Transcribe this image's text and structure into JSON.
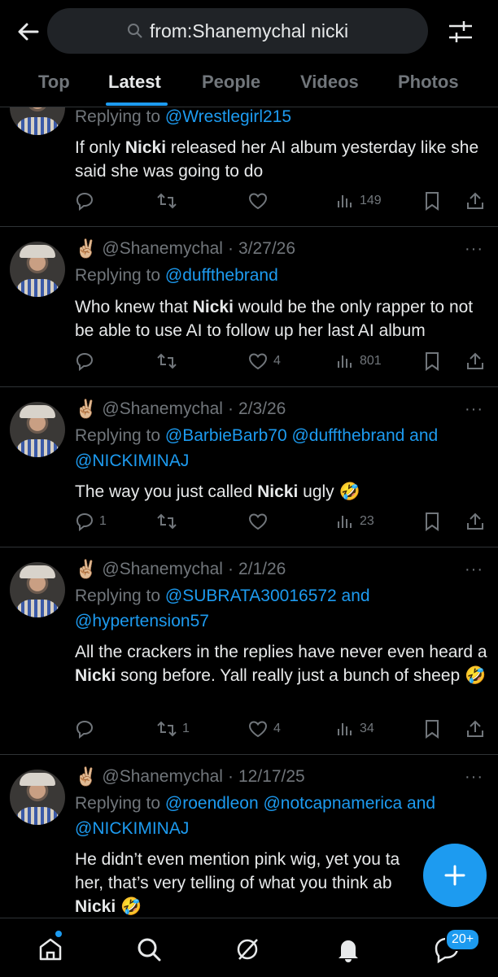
{
  "search": {
    "query": "from:Shanemychal nicki"
  },
  "tabs": [
    "Top",
    "Latest",
    "People",
    "Videos",
    "Photos"
  ],
  "tweets": [
    {
      "reply_prefix": "Replying to",
      "mentions": "@Wrestlegirl215",
      "text_a": "If only ",
      "text_b": "Nicki",
      "text_c": " released her AI album yesterday like she said she was going to do",
      "replies": "",
      "retweets": "",
      "likes": "",
      "views": "149"
    },
    {
      "emoji": "✌🏼",
      "handle": "@Shanemychal",
      "date": "3/27/26",
      "reply_prefix": "Replying to",
      "mentions": "@duffthebrand",
      "text_a": "Who knew that ",
      "text_b": "Nicki",
      "text_c": " would be the only rapper to not be able to use AI to follow up her last AI album",
      "replies": "",
      "retweets": "",
      "likes": "4",
      "views": "801"
    },
    {
      "emoji": "✌🏼",
      "handle": "@Shanemychal",
      "date": "2/3/26",
      "reply_prefix": "Replying to",
      "mentions": "@BarbieBarb70 @duffthebrand and @NICKIMINAJ",
      "text_a": "The way you just called ",
      "text_b": "Nicki",
      "text_c": " ugly 🤣",
      "replies": "1",
      "retweets": "",
      "likes": "",
      "views": "23"
    },
    {
      "emoji": "✌🏼",
      "handle": "@Shanemychal",
      "date": "2/1/26",
      "reply_prefix": "Replying to",
      "mentions": "@SUBRATA30016572 and @hypertension57",
      "text_a": "All the crackers in the replies have never even heard a ",
      "text_b": "Nicki",
      "text_c": " song before. Yall really just a bunch of sheep 🤣",
      "replies": "",
      "retweets": "1",
      "likes": "4",
      "views": "34"
    },
    {
      "emoji": "✌🏼",
      "handle": "@Shanemychal",
      "date": "12/17/25",
      "reply_prefix": "Replying to",
      "mentions": "@roendleon @notcapnamerica and @NICKIMINAJ",
      "text_a": "He didn’t even mention pink wig, yet you ta her, that’s very telling of what you think ab ",
      "text_b": "Nicki",
      "text_c": " 🤣"
    }
  ],
  "nav": {
    "messages_badge": "20+"
  },
  "colors": {
    "accent": "#1d9bf0",
    "background": "#000000",
    "muted": "#71767b",
    "text": "#e7e9ea"
  }
}
